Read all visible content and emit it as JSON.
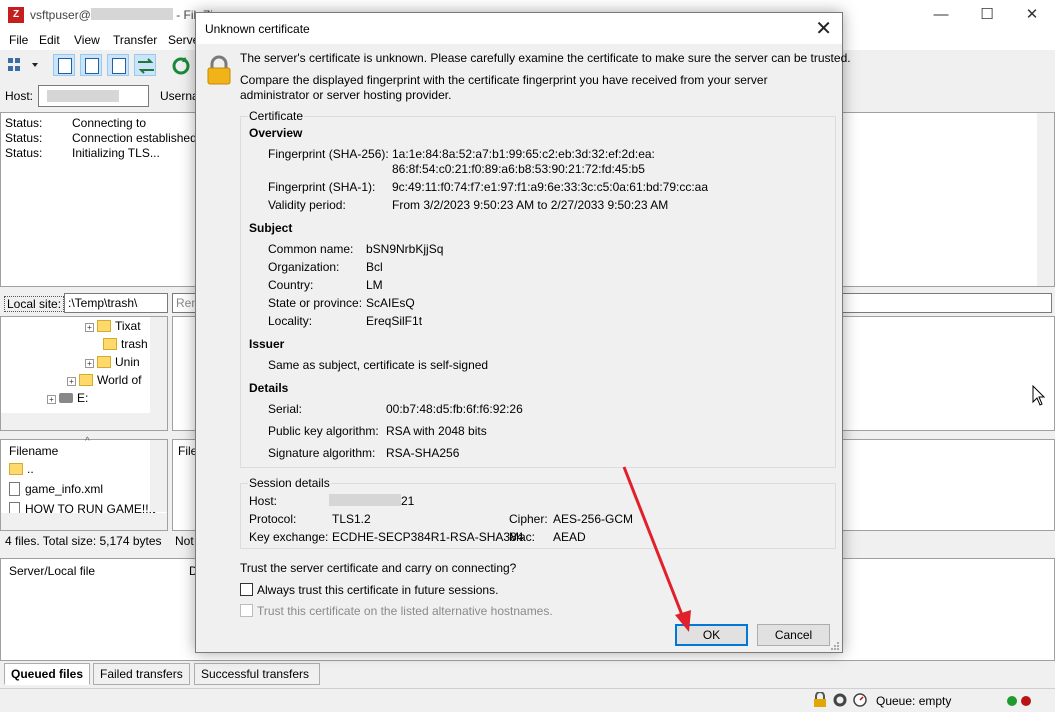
{
  "app": {
    "title_prefix": "vsftpuser@",
    "title_suffix": "- FileZi",
    "icon_letter": "Z",
    "window_controls": {
      "minimize": "—",
      "maximize": "☐",
      "close": "✕"
    }
  },
  "menu": {
    "file": "File",
    "edit": "Edit",
    "view": "View",
    "transfer": "Transfer",
    "server": "Serve"
  },
  "quickconnect": {
    "host_label": "Host:",
    "username_label": "Userna"
  },
  "log": [
    {
      "key": "Status:",
      "text": "Connecting to"
    },
    {
      "key": "Status:",
      "text": "Connection established"
    },
    {
      "key": "Status:",
      "text": "Initializing TLS..."
    }
  ],
  "local": {
    "site_label": "Local site:",
    "site_path": ":\\Temp\\trash\\",
    "tree": [
      {
        "label": "Tixat",
        "expand": "+"
      },
      {
        "label": "trash",
        "expand": ""
      },
      {
        "label": "Unin",
        "expand": "+"
      },
      {
        "label": "World of",
        "expand": "+"
      },
      {
        "label": "E:",
        "expand": "+"
      }
    ],
    "filename_header": "Filename",
    "files": [
      "..",
      "game_info.xml",
      "HOW TO RUN GAME!!.t"
    ],
    "summary": "4 files. Total size: 5,174 bytes"
  },
  "remote": {
    "site_label": "Rem",
    "filename_header": "File",
    "summary": "Not"
  },
  "queue": {
    "column_server": "Server/Local file",
    "column_direction": "D",
    "tabs": [
      "Queued files",
      "Failed transfers",
      "Successful transfers"
    ]
  },
  "statusbar": {
    "queue": "Queue: empty"
  },
  "dialog": {
    "title": "Unknown certificate",
    "close": "✕",
    "intro": "The server's certificate is unknown. Please carefully examine the certificate to make sure the server can be trusted.",
    "compare_line1": "Compare the displayed fingerprint with the certificate fingerprint you have received from your server",
    "compare_line2": "administrator or server hosting provider.",
    "certificate_group": "Certificate",
    "overview": {
      "heading": "Overview",
      "sha256_label": "Fingerprint (SHA-256):",
      "sha256_line1": "1a:1e:84:8a:52:a7:b1:99:65:c2:eb:3d:32:ef:2d:ea:",
      "sha256_line2": "86:8f:54:c0:21:f0:89:a6:b8:53:90:21:72:fd:45:b5",
      "sha1_label": "Fingerprint (SHA-1):",
      "sha1_value": "9c:49:11:f0:74:f7:e1:97:f1:a9:6e:33:3c:c5:0a:61:bd:79:cc:aa",
      "validity_label": "Validity period:",
      "validity_value": "From 3/2/2023 9:50:23 AM to 2/27/2033 9:50:23 AM"
    },
    "subject": {
      "heading": "Subject",
      "common_name_label": "Common name:",
      "common_name": "bSN9NrbKjjSq",
      "organization_label": "Organization:",
      "organization": "Bcl",
      "country_label": "Country:",
      "country": "LM",
      "state_label": "State or province:",
      "state": "ScAIEsQ",
      "locality_label": "Locality:",
      "locality": "EreqSilF1t"
    },
    "issuer": {
      "heading": "Issuer",
      "text": "Same as subject, certificate is self-signed"
    },
    "details": {
      "heading": "Details",
      "serial_label": "Serial:",
      "serial": "00:b7:48:d5:fb:6f:f6:92:26",
      "pubkey_label": "Public key algorithm:",
      "pubkey": "RSA with 2048 bits",
      "signature_label": "Signature algorithm:",
      "signature": "RSA-SHA256"
    },
    "session": {
      "group": "Session details",
      "host_label": "Host:",
      "host_suffix": "21",
      "protocol_label": "Protocol:",
      "protocol": "TLS1.2",
      "cipher_label": "Cipher:",
      "cipher": "AES-256-GCM",
      "kex_label": "Key exchange:",
      "kex": "ECDHE-SECP384R1-RSA-SHA384",
      "mac_label": "Mac:",
      "mac": "AEAD"
    },
    "question": "Trust the server certificate and carry on connecting?",
    "always_trust": "Always trust this certificate in future sessions.",
    "trust_alt": "Trust this certificate on the listed alternative hostnames.",
    "ok": "OK",
    "cancel": "Cancel"
  },
  "colors": {
    "accent": "#0078d7",
    "arrow": "#e0202a"
  }
}
